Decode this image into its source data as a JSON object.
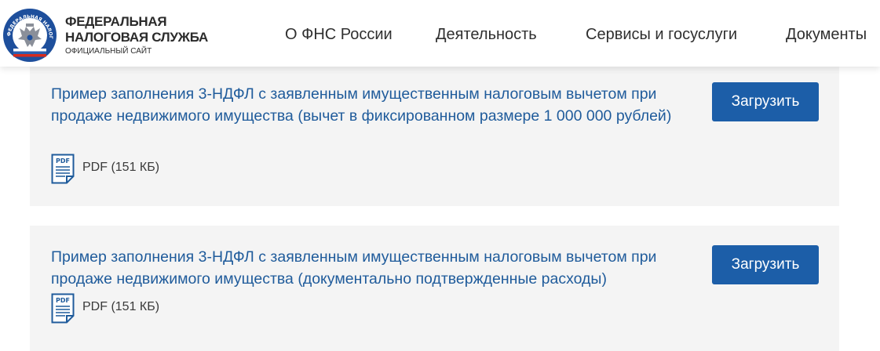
{
  "header": {
    "brand_line1": "ФЕДЕРАЛЬНАЯ",
    "brand_line2": "НАЛОГОВАЯ СЛУЖБА",
    "brand_sub": "ОФИЦИАЛЬНЫЙ САЙТ",
    "emblem_text": "ФЕДЕРАЛЬНАЯ НАЛОГОВАЯ СЛУЖБА"
  },
  "nav": {
    "items": [
      {
        "label": "О ФНС России"
      },
      {
        "label": "Деятельность"
      },
      {
        "label": "Сервисы и госуслуги"
      },
      {
        "label": "Документы"
      }
    ]
  },
  "documents": [
    {
      "title": "Пример заполнения 3-НДФЛ с заявленным имущественным налоговым вычетом при продаже недвижимого имущества (вычет в фиксированном размере 1 000 000 рублей)",
      "file_info": "PDF (151 КБ)",
      "button_label": "Загрузить"
    },
    {
      "title": "Пример заполнения 3-НДФЛ с заявленным имущественным налоговым вычетом при продаже недвижимого имущества (документально подтвержденные расходы)",
      "file_info": "PDF (151 КБ)",
      "button_label": "Загрузить"
    }
  ],
  "icons": {
    "file": "pdf-file-icon",
    "logo": "fns-emblem-logo"
  },
  "colors": {
    "link": "#1f5b9b",
    "button": "#1c5ea8",
    "card_bg": "#f4f4f4",
    "emblem_blue": "#1e4f9c"
  }
}
